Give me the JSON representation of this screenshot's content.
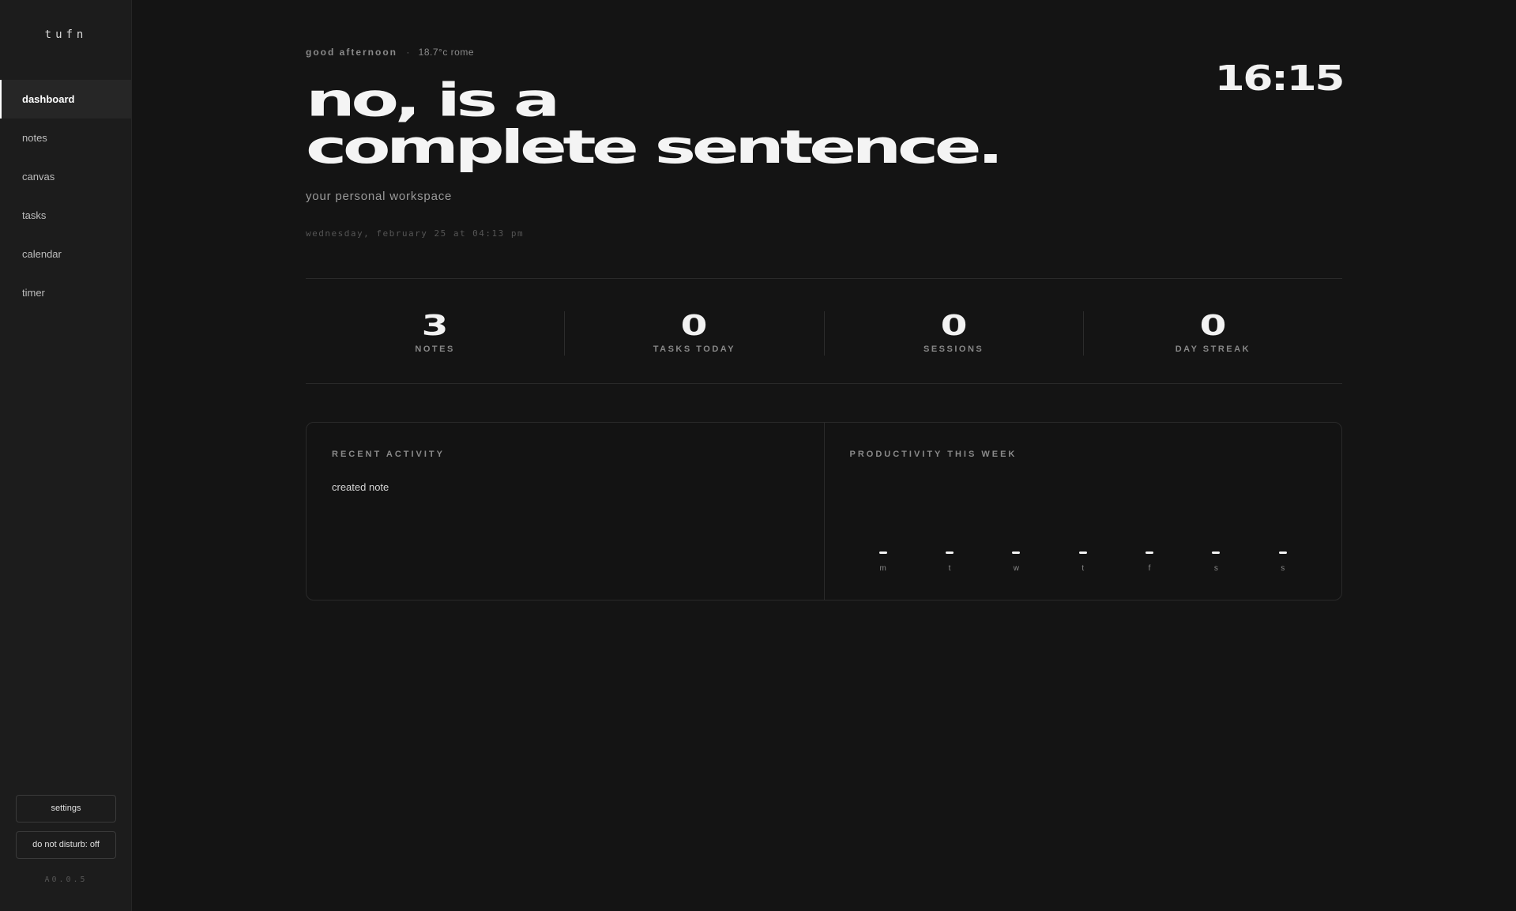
{
  "sidebar": {
    "logo": "tufn",
    "items": [
      {
        "label": "dashboard",
        "active": true
      },
      {
        "label": "notes"
      },
      {
        "label": "canvas"
      },
      {
        "label": "tasks"
      },
      {
        "label": "calendar"
      },
      {
        "label": "timer"
      }
    ],
    "settings_label": "settings",
    "dnd_label": "do not disturb: off",
    "version": "A0.0.5"
  },
  "header": {
    "greeting": "good afternoon",
    "separator": "·",
    "weather": "18.7°c rome",
    "clock": "16:15",
    "headline_line1": "no, is a",
    "headline_line2": "complete sentence.",
    "subtitle": "your personal workspace",
    "datestamp": "wednesday, february 25 at 04:13 pm"
  },
  "stats": [
    {
      "value": "3",
      "label": "NOTES"
    },
    {
      "value": "0",
      "label": "TASKS TODAY"
    },
    {
      "value": "0",
      "label": "SESSIONS"
    },
    {
      "value": "0",
      "label": "DAY STREAK"
    }
  ],
  "activity": {
    "title": "RECENT ACTIVITY",
    "items": [
      "created note"
    ]
  },
  "productivity": {
    "title": "PRODUCTIVITY THIS WEEK"
  },
  "chart_data": {
    "type": "bar",
    "categories": [
      "m",
      "t",
      "w",
      "t",
      "f",
      "s",
      "s"
    ],
    "values": [
      0,
      0,
      0,
      0,
      0,
      0,
      0
    ],
    "title": "PRODUCTIVITY THIS WEEK",
    "xlabel": "",
    "ylabel": "",
    "grid": false,
    "colors": {
      "bar": "#f2f2f2"
    }
  },
  "colors": {
    "background": "#141414",
    "sidebar": "#1c1c1c",
    "accent": "#ffffff"
  }
}
